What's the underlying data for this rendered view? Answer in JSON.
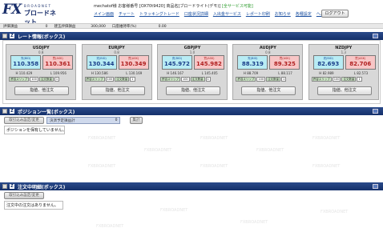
{
  "brand": {
    "fx": "FX",
    "small": "BROADNET",
    "jp": "ブロードネット"
  },
  "header": {
    "userline": "mechatof様  お客様番号 [OX70t9420]  商品名[ブロードライト(デモ)]",
    "tag": "[全サービス可能]",
    "logout": "ログアウト"
  },
  "nav": [
    "メイン画面",
    "チャート",
    "トラッキングトレード",
    "口座状況詳細",
    "入出金サービス",
    "レポート印刷",
    "お知らせ",
    "各種設定",
    "ヘルプ"
  ],
  "evalbar": {
    "items": [
      {
        "label": "評価損益",
        "value": "0"
      },
      {
        "label": "建玉評価損益",
        "value": "300,000"
      },
      {
        "label": "口座維持率(%)",
        "value": "0.00"
      }
    ]
  },
  "sections": {
    "rates": "レート情報(ボックス)",
    "positions": "ポジション一覧(ボックス)",
    "orders": "注文中明細(ボックス)"
  },
  "rates": [
    {
      "pair": "USDJPY",
      "spread": "0.8",
      "bid_label": "売(BID)",
      "ask_label": "買(ASK)",
      "bid": "110.358",
      "ask": "110.361",
      "high": "110.429",
      "low": "109.956",
      "slip_label": "許容スリップ",
      "slip": "100",
      "lots_label": "注文数量",
      "lots": "1",
      "order_btn": "指値、他注文"
    },
    {
      "pair": "EURJPY",
      "spread": "0.8",
      "bid_label": "売(BID)",
      "ask_label": "買(ASK)",
      "bid": "130.344",
      "ask": "130.349",
      "high": "130.586",
      "low": "130.169",
      "slip_label": "許容スリップ",
      "slip": "100",
      "lots_label": "注文数量",
      "lots": "1",
      "order_btn": "指値、他注文"
    },
    {
      "pair": "GBPJPY",
      "spread": "1.0",
      "bid_label": "売(BID)",
      "ask_label": "買(ASK)",
      "bid": "145.972",
      "ask": "145.982",
      "high": "146.167",
      "low": "145.405",
      "slip_label": "許容スリップ",
      "slip": "100",
      "lots_label": "注文数量",
      "lots": "1",
      "order_btn": "指値、他注文"
    },
    {
      "pair": "AUDJPY",
      "spread": "0.8",
      "bid_label": "売(BID)",
      "ask_label": "買(ASK)",
      "bid": "88.319",
      "ask": "89.325",
      "high": "88.709",
      "low": "88.117",
      "slip_label": "許容スリップ",
      "slip": "100",
      "lots_label": "注文数量",
      "lots": "1",
      "order_btn": "指値、他注文"
    },
    {
      "pair": "NZDJPY",
      "spread": "1.3",
      "bid_label": "売(BID)",
      "ask_label": "買(ASK)",
      "bid": "82.693",
      "ask": "82.706",
      "high": "82.989",
      "low": "82.573",
      "slip_label": "許容スリップ",
      "slip": "100",
      "lots_label": "注文数量",
      "lots": "1",
      "order_btn": "指値、他注文"
    }
  ],
  "positions": {
    "refresh_btn": "取引込み設定/変更",
    "select_label": "決済予定損益計",
    "select_count": "0",
    "action_btn": "集計",
    "empty_msg": "ポジションを保有していません。"
  },
  "orders": {
    "refresh_btn": "取引込み設定/変更",
    "empty_msg": "注文中の注文はありません。"
  },
  "watermark": "FXBROADNET"
}
